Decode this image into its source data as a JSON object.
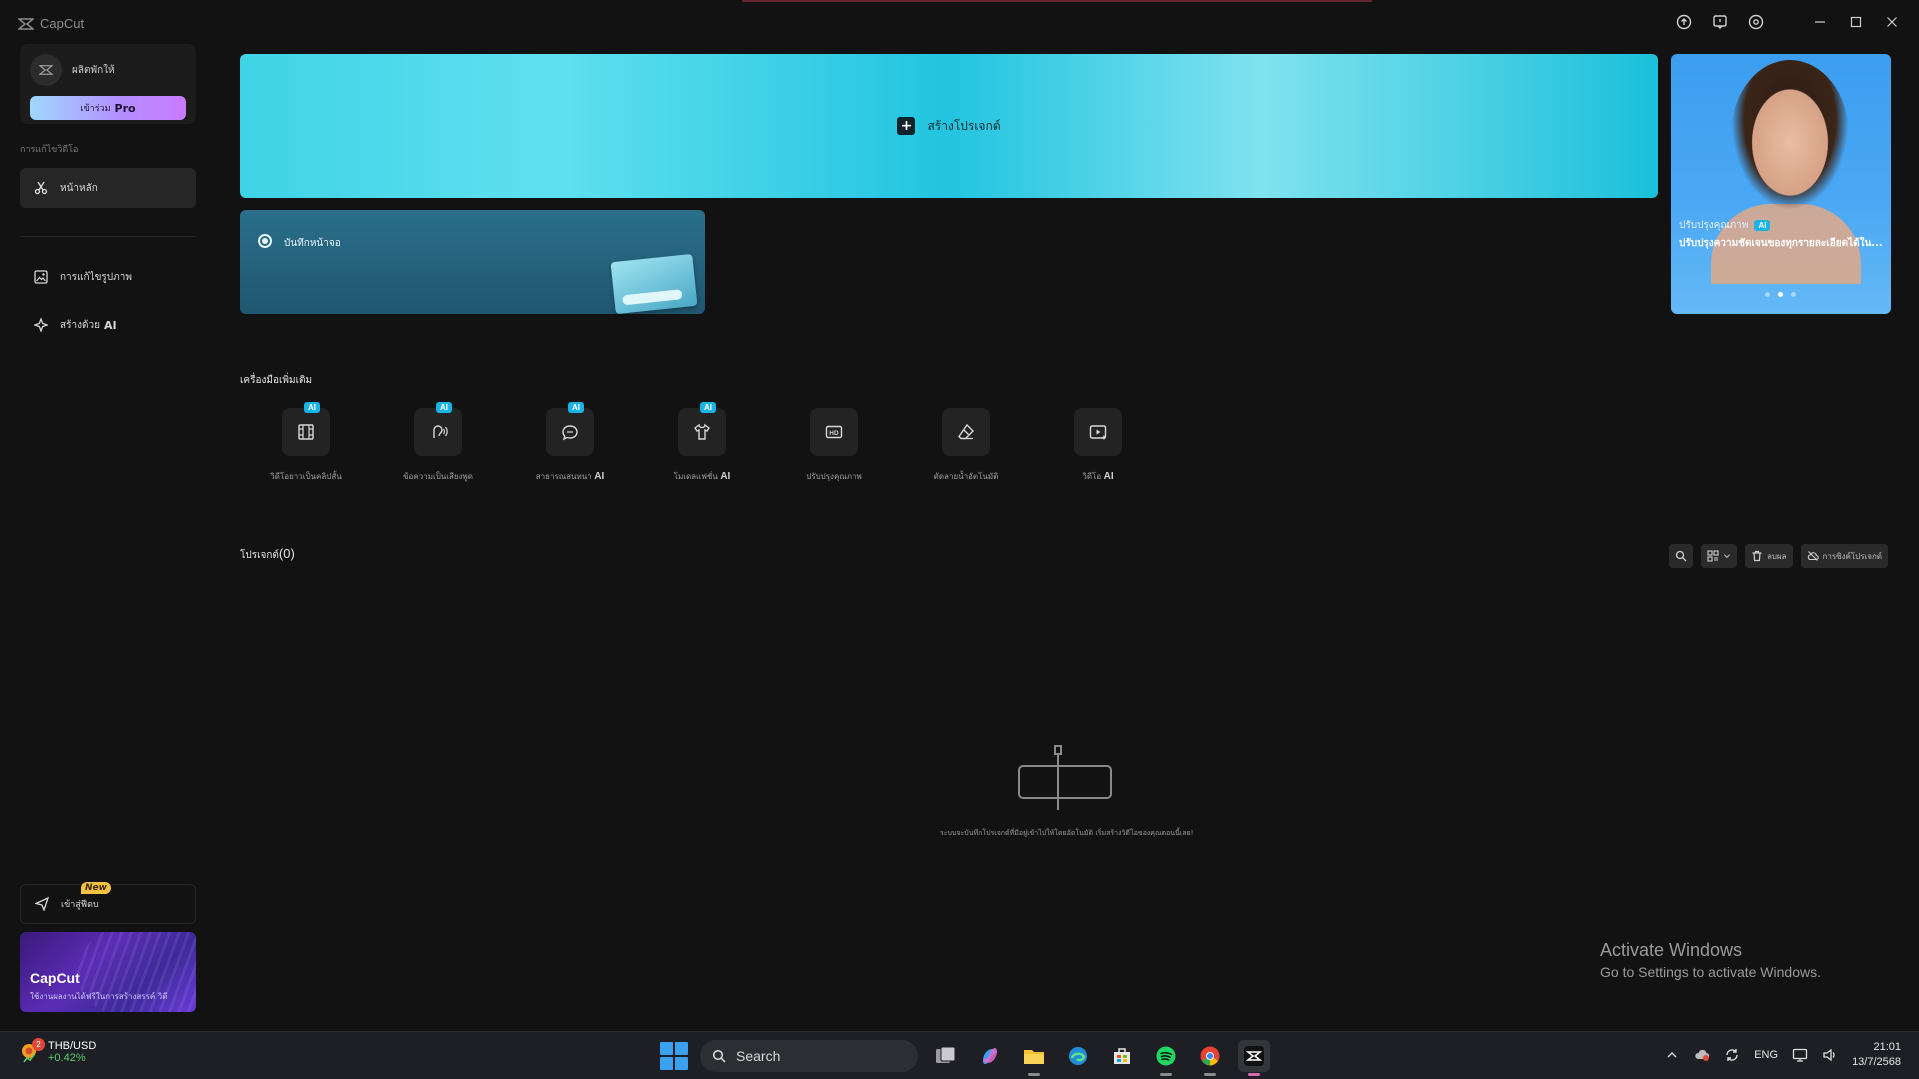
{
  "app": {
    "name": "CapCut"
  },
  "sidebar": {
    "account_name": "ผลิตพักให้",
    "pro_button_prefix": "เข้าร่วม",
    "pro_button_label": "Pro",
    "section_label": "การแก้ไขวิดีโอ",
    "items": [
      {
        "label": "หน้าหลัก",
        "active": true
      },
      {
        "label": "การแก้ไขรูปภาพ",
        "active": false
      },
      {
        "label": "สร้างด้วย",
        "label_suffix": "AI",
        "active": false
      }
    ],
    "feedback_label": "เข้าสู่ฟีดบ",
    "new_badge": "New",
    "promo_title": "CapCut",
    "promo_subtitle": "ใช้งานผลงานได้ฟรีในการสร้างสรรค์ วิดี"
  },
  "main": {
    "create_project_label": "สร้างโปรเจกต์",
    "record_screen_label": "บันทึกหน้าจอ",
    "feature_card": {
      "title": "ปรับปรุงคุณภาพ",
      "ai_tag": "AI",
      "description": "ปรับปรุงความชัดเจนของทุกรายละเอียดได้ใน..."
    },
    "tools_title": "เครื่องมือเพิ่มเติม",
    "tools": [
      {
        "label": "วิดีโอยาวเป็นคลิปสั้น",
        "suffix": "",
        "ai": true,
        "icon": "film-icon"
      },
      {
        "label": "ข้อความเป็นเสียงพูด",
        "suffix": "",
        "ai": true,
        "icon": "voice-icon"
      },
      {
        "label": "สาธารณสนทนา",
        "suffix": "AI",
        "ai": true,
        "icon": "chat-icon"
      },
      {
        "label": "โมเดลแฟชั่น",
        "suffix": "AI",
        "ai": true,
        "icon": "shirt-icon"
      },
      {
        "label": "ปรับปรุงคุณภาพ",
        "suffix": "",
        "ai": false,
        "icon": "hd-icon"
      },
      {
        "label": "ตัดลายน้ำอัตโนมัติ",
        "suffix": "",
        "ai": false,
        "icon": "eraser-icon"
      },
      {
        "label": "วิดีโอ",
        "suffix": "AI",
        "ai": false,
        "icon": "video-ai-icon"
      }
    ],
    "projects_label": "โปรเจกต์",
    "projects_count": "(0)",
    "delete_label": "ลบผล",
    "cloud_label": "การซิงค์โปรเจกต์",
    "empty_message": "ระบบจะบันทึกโปรเจกต์ที่มีอยู่เข้าไปให้โดยอัตโนมัติ เริ่มสร้างวิดีโอของคุณตอนนี้เลย!"
  },
  "watermark": {
    "line1": "Activate Windows",
    "line2": "Go to Settings to activate Windows."
  },
  "taskbar": {
    "ticker_badge": "2",
    "ticker_pair": "THB/USD",
    "ticker_change": "+0.42%",
    "search_label": "Search",
    "language": "ENG",
    "time": "21:01",
    "date": "13/7/2568"
  }
}
